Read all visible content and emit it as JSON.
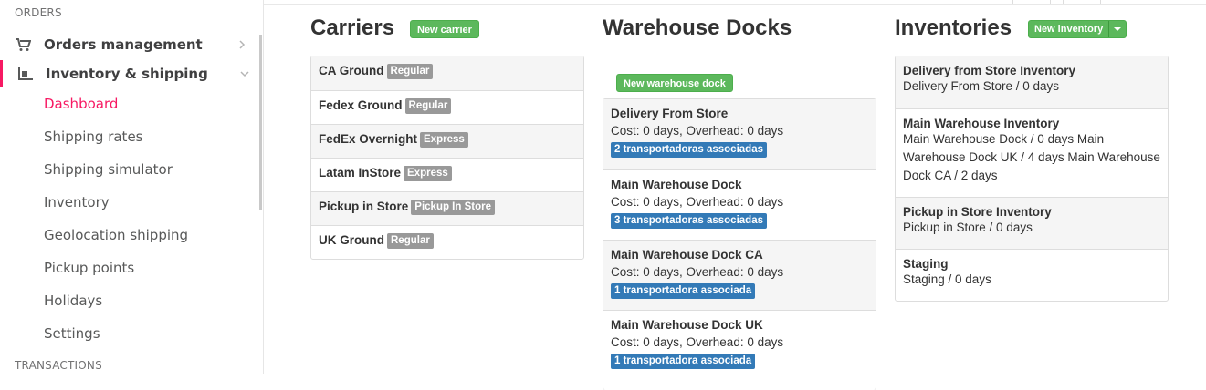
{
  "sidebar": {
    "section_orders": "ORDERS",
    "section_transactions": "TRANSACTIONS",
    "orders_management": "Orders management",
    "inventory_shipping": "Inventory & shipping",
    "sub_items": [
      {
        "label": "Dashboard",
        "active": true
      },
      {
        "label": "Shipping rates"
      },
      {
        "label": "Shipping simulator"
      },
      {
        "label": "Inventory"
      },
      {
        "label": "Geolocation shipping"
      },
      {
        "label": "Pickup points"
      },
      {
        "label": "Holidays"
      },
      {
        "label": "Settings"
      }
    ],
    "accent_color": "#f71963"
  },
  "carriers": {
    "title": "Carriers",
    "new_button": "New carrier",
    "items": [
      {
        "name": "CA Ground",
        "badge": "Regular"
      },
      {
        "name": "Fedex Ground",
        "badge": "Regular"
      },
      {
        "name": "FedEx Overnight",
        "badge": "Express"
      },
      {
        "name": "Latam InStore",
        "badge": "Express"
      },
      {
        "name": "Pickup in Store",
        "badge": "Pickup In Store"
      },
      {
        "name": "UK Ground",
        "badge": "Regular"
      }
    ]
  },
  "docks": {
    "title": "Warehouse Docks",
    "new_button": "New warehouse dock",
    "items": [
      {
        "name": "Delivery From Store",
        "cost": "Cost: 0 days, Overhead: 0 days",
        "badge": "2 transportadoras associadas"
      },
      {
        "name": "Main Warehouse Dock",
        "cost": "Cost: 0 days, Overhead: 0 days",
        "badge": "3 transportadoras associadas"
      },
      {
        "name": "Main Warehouse Dock CA",
        "cost": "Cost: 0 days, Overhead: 0 days",
        "badge": "1 transportadora associada"
      },
      {
        "name": "Main Warehouse Dock UK",
        "cost": "Cost: 0 days, Overhead: 0 days",
        "badge": "1 transportadora associada"
      }
    ]
  },
  "inventories": {
    "title": "Inventories",
    "new_button": "New inventory",
    "items": [
      {
        "name": "Delivery from Store Inventory",
        "detail": "Delivery From Store / 0 days"
      },
      {
        "name": "Main Warehouse Inventory",
        "detail": "Main Warehouse Dock / 0 days Main Warehouse Dock UK / 4 days Main Warehouse Dock CA / 2 days"
      },
      {
        "name": "Pickup in Store Inventory",
        "detail": "Pickup in Store / 0 days"
      },
      {
        "name": "Staging",
        "detail": "Staging / 0 days"
      }
    ]
  }
}
